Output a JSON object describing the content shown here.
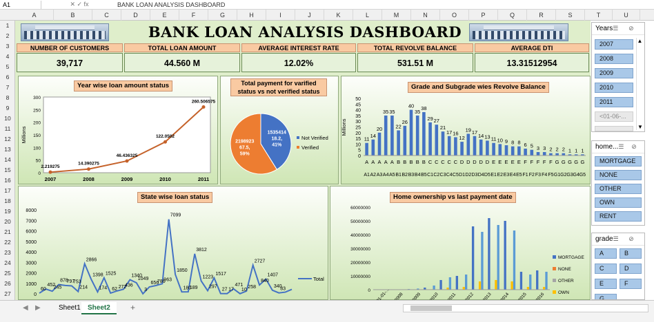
{
  "formula_bar": {
    "name_box": "A1",
    "fx": "✕  ✓  fx",
    "formula": "BANK LOAN ANALYSIS DASHBOARD"
  },
  "columns": [
    "A",
    "B",
    "C",
    "D",
    "E",
    "F",
    "G",
    "H",
    "I",
    "J",
    "K",
    "L",
    "M",
    "N",
    "O",
    "P",
    "Q",
    "R",
    "S",
    "T",
    "U"
  ],
  "rows": [
    "1",
    "2",
    "3",
    "4",
    "5",
    "6",
    "7",
    "8",
    "9",
    "10",
    "11",
    "12",
    "13",
    "14",
    "15",
    "16",
    "17",
    "18",
    "19",
    "20",
    "21",
    "22",
    "23",
    "24",
    "25",
    "26",
    "27"
  ],
  "title": "BANK LOAN ANALYSIS DASHBOARD",
  "kpis": [
    {
      "label": "NUMBER OF CUSTOMERS",
      "value": "39,717"
    },
    {
      "label": "TOTAL LOAN AMOUNT",
      "value": "44.560 M"
    },
    {
      "label": "AVERAGE  INTEREST RATE",
      "value": "12.02%"
    },
    {
      "label": "TOTAL REVOLVE BALANCE",
      "value": "531.51 M"
    },
    {
      "label": "AVERAGE DTI",
      "value": "13.31512954"
    }
  ],
  "panels": {
    "year": "Year wise loan amount status",
    "pie": "Total payment for varified status vs not verified status",
    "grade": "Grade and Subgrade wies Revolve Balance",
    "state": "State wise loan status",
    "home": "Home ownership vs last payment date"
  },
  "colors": {
    "orange": "#c5622a",
    "blue": "#4472c4",
    "pie_orange": "#ed7d31",
    "grey": "#a5a5a5",
    "yellow": "#ffc000",
    "light_blue": "#5b9bd5"
  },
  "chart_data": [
    {
      "type": "line",
      "title": "Year wise loan amount status",
      "ylabel": "Millions",
      "x": [
        "2007",
        "2008",
        "2009",
        "2010",
        "2011"
      ],
      "values": [
        2.219275,
        14.390275,
        46.436325,
        122.0502,
        260.506575
      ],
      "data_labels": [
        "2.219275",
        "14.390275",
        "46.436325",
        "122.0502",
        "260.506575"
      ],
      "ylim": [
        0,
        300
      ],
      "yticks": [
        "0",
        "50",
        "100",
        "150",
        "200",
        "250",
        "300"
      ]
    },
    {
      "type": "pie",
      "title": "Total payment for varified status vs not verified status",
      "slices": [
        {
          "name": "Not Verified",
          "value": 1535414,
          "label": "1535414\n18.2,\n41%"
        },
        {
          "name": "Verified",
          "value": 2198923,
          "label": "2198923\n67.5,\n59%"
        }
      ],
      "legend": [
        "Not Verified",
        "Verified"
      ]
    },
    {
      "type": "bar",
      "title": "Grade and Subgrade wies Revolve Balance",
      "ylabel": "Millions",
      "ylim": [
        0,
        50
      ],
      "yticks": [
        "0",
        "5",
        "10",
        "15",
        "20",
        "25",
        "30",
        "35",
        "40",
        "45",
        "50"
      ],
      "grades": [
        "A",
        "A",
        "A",
        "A",
        "A",
        "B",
        "B",
        "B",
        "B",
        "B",
        "C",
        "C",
        "C",
        "C",
        "C",
        "D",
        "D",
        "D",
        "D",
        "D",
        "E",
        "E",
        "E",
        "E",
        "E",
        "F",
        "F",
        "F",
        "F",
        "F",
        "G",
        "G",
        "G",
        "G",
        "G"
      ],
      "categories": [
        "A1",
        "A2",
        "A3",
        "A4",
        "A5",
        "B1",
        "B2",
        "B3",
        "B4",
        "B5",
        "C1",
        "C2",
        "C3",
        "C4",
        "C5",
        "D1",
        "D2",
        "D3",
        "D4",
        "D5",
        "E1",
        "E2",
        "E3",
        "E4",
        "E5",
        "F1",
        "F2",
        "F3",
        "F4",
        "F5",
        "G1",
        "G2",
        "G3",
        "G4",
        "G5"
      ],
      "values": [
        11,
        14,
        20,
        35,
        35,
        22,
        26,
        40,
        35,
        38,
        29,
        27,
        21,
        17,
        16,
        12,
        19,
        17,
        14,
        13,
        11,
        10,
        9,
        8,
        8,
        6,
        5,
        3,
        3,
        2,
        2,
        2,
        1,
        1,
        1
      ]
    },
    {
      "type": "line",
      "title": "State wise loan status",
      "legend": [
        "Total"
      ],
      "ylim": [
        0,
        8000
      ],
      "yticks": [
        "0",
        "1000",
        "2000",
        "3000",
        "4000",
        "5000",
        "6000",
        "7000",
        "8000"
      ],
      "values": [
        60,
        452,
        245,
        878,
        797,
        753,
        214,
        2866,
        1398,
        174,
        1525,
        62,
        272,
        436,
        1340,
        1049,
        3,
        656,
        786,
        963,
        7099,
        1850,
        180,
        189,
        3812,
        1223,
        297,
        1517,
        27,
        17,
        471,
        10,
        258,
        2727,
        840,
        1407,
        340,
        83,
        160,
        420
      ],
      "data_labels": [
        "60",
        "452",
        "245",
        "878",
        "797",
        "753",
        "214",
        "2866",
        "1398",
        "174",
        "1525",
        "62",
        "272",
        "436",
        "1340",
        "1049",
        "3",
        "656",
        "786",
        "963",
        "7099",
        "1850",
        "180",
        "189",
        "3812",
        "1223",
        "297",
        "1517",
        "27",
        "17",
        "471",
        "10",
        "258",
        "2727",
        "840",
        "1407",
        "340",
        "83"
      ]
    },
    {
      "type": "bar",
      "title": "Home ownership vs last payment date",
      "ylim": [
        0,
        60000000
      ],
      "yticks": [
        "0",
        "10000000",
        "20000000",
        "30000000",
        "40000000",
        "50000000",
        "60000000"
      ],
      "x": [
        "2001-01-...",
        "2008",
        "2009",
        "2010",
        "2011",
        "2012",
        "2013",
        "2014",
        "2015",
        "2016"
      ],
      "series": [
        {
          "name": "MORTGAGE",
          "values": [
            0,
            100000,
            400000,
            1500000,
            7000000,
            10000000,
            46000000,
            52000000,
            50000000,
            13000000,
            14000000
          ]
        },
        {
          "name": "NONE",
          "values": [
            0,
            0,
            0,
            0,
            0,
            0,
            0,
            0,
            0,
            0,
            0
          ]
        },
        {
          "name": "OTHER",
          "values": [
            0,
            0,
            0,
            100000,
            200000,
            0,
            0,
            0,
            0,
            0,
            0
          ]
        },
        {
          "name": "OWN",
          "values": [
            0,
            0,
            100000,
            300000,
            1500000,
            2000000,
            6000000,
            7000000,
            6000000,
            2000000,
            2000000
          ]
        },
        {
          "name": "RENT",
          "values": [
            0,
            200000,
            800000,
            3000000,
            9000000,
            11000000,
            42000000,
            47000000,
            43000000,
            11000000,
            13000000
          ]
        }
      ],
      "legend": [
        "MORTGAGE",
        "NONE",
        "OTHER",
        "OWN",
        "RENT"
      ]
    }
  ],
  "slicers": {
    "years": {
      "title": "Years",
      "items": [
        "2007",
        "2008",
        "2009",
        "2010",
        "2011",
        "<01-06-...",
        "<02-12..."
      ]
    },
    "home": {
      "title": "home...",
      "items": [
        "MORTGAGE",
        "NONE",
        "OTHER",
        "OWN",
        "RENT"
      ]
    },
    "grade": {
      "title": "grade",
      "items": [
        "A",
        "B",
        "C",
        "D",
        "E",
        "F",
        "G"
      ]
    }
  },
  "tabs": [
    "Sheet1",
    "Sheet2"
  ],
  "add_sheet": "+"
}
